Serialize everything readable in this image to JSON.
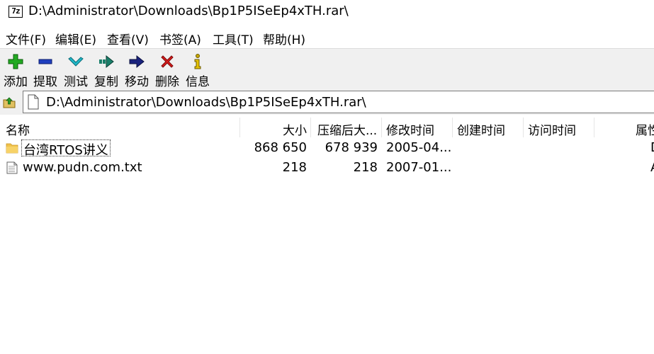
{
  "window": {
    "title": "D:\\Administrator\\Downloads\\Bp1P5ISeEp4xTH.rar\\",
    "app_icon_text": "7z"
  },
  "menu": [
    {
      "label": "文件(F)"
    },
    {
      "label": "编辑(E)"
    },
    {
      "label": "查看(V)"
    },
    {
      "label": "书签(A)"
    },
    {
      "label": "工具(T)"
    },
    {
      "label": "帮助(H)"
    }
  ],
  "toolbar": [
    {
      "label": "添加",
      "icon": "plus-icon",
      "color": "#22aa22"
    },
    {
      "label": "提取",
      "icon": "minus-icon",
      "color": "#1f3fbf"
    },
    {
      "label": "测试",
      "icon": "check-icon",
      "color": "#20b8c8"
    },
    {
      "label": "复制",
      "icon": "copy-arrow-icon",
      "color": "#1a7f6a"
    },
    {
      "label": "移动",
      "icon": "move-arrow-icon",
      "color": "#1a237e"
    },
    {
      "label": "删除",
      "icon": "delete-icon",
      "color": "#d81b1b"
    },
    {
      "label": "信息",
      "icon": "info-icon",
      "color": "#c8a800"
    }
  ],
  "address": {
    "path": "D:\\Administrator\\Downloads\\Bp1P5ISeEp4xTH.rar\\"
  },
  "columns": [
    "名称",
    "大小",
    "压缩后大...",
    "修改时间",
    "创建时间",
    "访问时间",
    "属性"
  ],
  "rows": [
    {
      "name": "台湾RTOS讲义",
      "size": "868 650",
      "packed": "678 939",
      "modified": "2005-04...",
      "created": "",
      "accessed": "",
      "attr": "D",
      "type": "folder"
    },
    {
      "name": "www.pudn.com.txt",
      "size": "218",
      "packed": "218",
      "modified": "2007-01...",
      "created": "",
      "accessed": "",
      "attr": "A",
      "type": "file"
    }
  ]
}
